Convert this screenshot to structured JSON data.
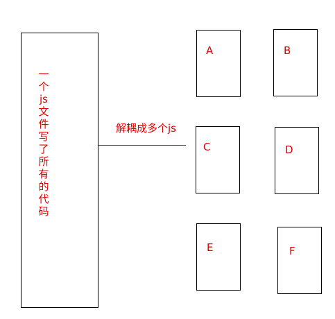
{
  "main_box": {
    "label_chars": [
      "一",
      "个",
      "js",
      "文",
      "件",
      "写",
      "了",
      "所",
      "有",
      "的",
      "代",
      "码"
    ]
  },
  "connector": {
    "label": "解耦成多个js"
  },
  "boxes": [
    {
      "label": "A"
    },
    {
      "label": "B"
    },
    {
      "label": "C"
    },
    {
      "label": "D"
    },
    {
      "label": "E"
    },
    {
      "label": "F"
    }
  ],
  "colors": {
    "text": "#e00000",
    "line": "#e00000",
    "border": "#000000",
    "background": "#ffffff"
  }
}
